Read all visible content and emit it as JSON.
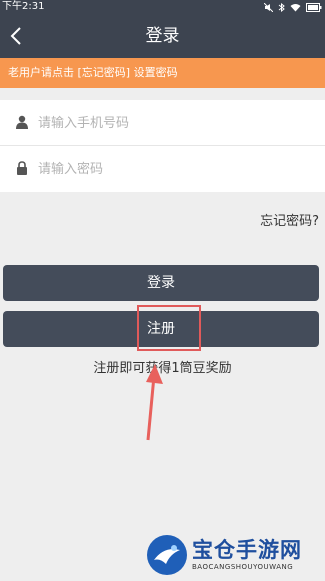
{
  "status_bar": {
    "time": "下午2:31",
    "icons": [
      "mute-icon",
      "bluetooth-icon",
      "wifi-icon",
      "battery-icon"
    ]
  },
  "header": {
    "title": "登录",
    "back_icon": "chevron-left-icon"
  },
  "notice": {
    "text": "老用户请点击 [忘记密码] 设置密码"
  },
  "form": {
    "phone": {
      "placeholder": "请输入手机号码",
      "value": "",
      "icon": "person-icon"
    },
    "password": {
      "placeholder": "请输入密码",
      "value": "",
      "icon": "lock-icon"
    }
  },
  "forgot_link": "忘记密码?",
  "buttons": {
    "login": "登录",
    "register": "注册"
  },
  "bonus_text": "注册即可获得1筒豆奖励",
  "watermark": {
    "name": "宝仓手游网",
    "sub": "BAOCANGSHOUYOUWANG"
  },
  "colors": {
    "header_bg": "#3d4450",
    "notice_bg": "#f7974f",
    "button_bg": "#444c5a",
    "highlight": "#e05a5a",
    "page_bg": "#eeeeee"
  }
}
